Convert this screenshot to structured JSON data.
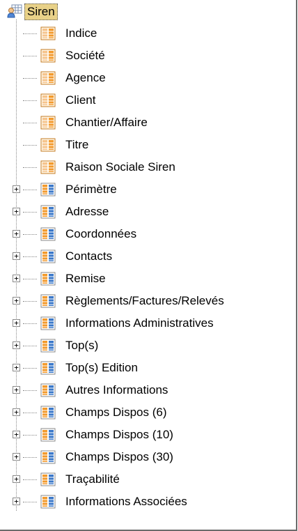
{
  "tree": {
    "root": {
      "label": "Siren",
      "icon": "user-table-icon"
    },
    "fields": [
      {
        "label": "Indice",
        "icon": "field-icon"
      },
      {
        "label": "Société",
        "icon": "field-icon"
      },
      {
        "label": "Agence",
        "icon": "field-icon"
      },
      {
        "label": "Client",
        "icon": "field-icon"
      },
      {
        "label": "Chantier/Affaire",
        "icon": "field-icon"
      },
      {
        "label": "Titre",
        "icon": "field-icon"
      },
      {
        "label": "Raison Sociale Siren",
        "icon": "field-icon"
      }
    ],
    "groups": [
      {
        "label": "Périmètre",
        "icon": "group-table-icon",
        "expander": "+"
      },
      {
        "label": "Adresse",
        "icon": "group-table-icon",
        "expander": "+"
      },
      {
        "label": "Coordonnées",
        "icon": "group-table-icon",
        "expander": "+"
      },
      {
        "label": "Contacts",
        "icon": "group-table-icon",
        "expander": "+"
      },
      {
        "label": "Remise",
        "icon": "group-table-icon",
        "expander": "+"
      },
      {
        "label": "Règlements/Factures/Relevés",
        "icon": "group-table-icon",
        "expander": "+"
      },
      {
        "label": "Informations Administratives",
        "icon": "group-table-icon",
        "expander": "+"
      },
      {
        "label": "Top(s)",
        "icon": "group-table-icon",
        "expander": "+"
      },
      {
        "label": "Top(s) Edition",
        "icon": "group-table-icon",
        "expander": "+"
      },
      {
        "label": "Autres Informations",
        "icon": "group-table-icon",
        "expander": "+"
      },
      {
        "label": "Champs Dispos (6)",
        "icon": "group-table-icon",
        "expander": "+"
      },
      {
        "label": "Champs Dispos (10)",
        "icon": "group-table-icon",
        "expander": "+"
      },
      {
        "label": "Champs Dispos (30)",
        "icon": "group-table-icon",
        "expander": "+"
      },
      {
        "label": "Traçabilité",
        "icon": "group-table-icon",
        "expander": "+"
      },
      {
        "label": "Informations Associées",
        "icon": "group-table-icon",
        "expander": "+"
      }
    ],
    "colors": {
      "selection": "#e8d188",
      "field_icon_orange": "#f39a2c",
      "group_icon_blue": "#3b78c9"
    }
  }
}
